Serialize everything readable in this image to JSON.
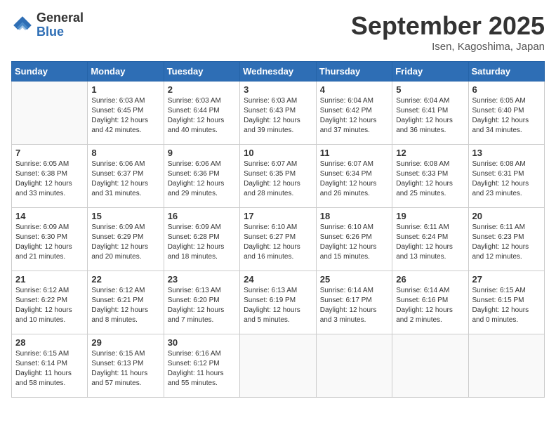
{
  "header": {
    "logo_general": "General",
    "logo_blue": "Blue",
    "title": "September 2025",
    "subtitle": "Isen, Kagoshima, Japan"
  },
  "days_of_week": [
    "Sunday",
    "Monday",
    "Tuesday",
    "Wednesday",
    "Thursday",
    "Friday",
    "Saturday"
  ],
  "weeks": [
    [
      {
        "day": "",
        "info": ""
      },
      {
        "day": "1",
        "info": "Sunrise: 6:03 AM\nSunset: 6:45 PM\nDaylight: 12 hours\nand 42 minutes."
      },
      {
        "day": "2",
        "info": "Sunrise: 6:03 AM\nSunset: 6:44 PM\nDaylight: 12 hours\nand 40 minutes."
      },
      {
        "day": "3",
        "info": "Sunrise: 6:03 AM\nSunset: 6:43 PM\nDaylight: 12 hours\nand 39 minutes."
      },
      {
        "day": "4",
        "info": "Sunrise: 6:04 AM\nSunset: 6:42 PM\nDaylight: 12 hours\nand 37 minutes."
      },
      {
        "day": "5",
        "info": "Sunrise: 6:04 AM\nSunset: 6:41 PM\nDaylight: 12 hours\nand 36 minutes."
      },
      {
        "day": "6",
        "info": "Sunrise: 6:05 AM\nSunset: 6:40 PM\nDaylight: 12 hours\nand 34 minutes."
      }
    ],
    [
      {
        "day": "7",
        "info": "Sunrise: 6:05 AM\nSunset: 6:38 PM\nDaylight: 12 hours\nand 33 minutes."
      },
      {
        "day": "8",
        "info": "Sunrise: 6:06 AM\nSunset: 6:37 PM\nDaylight: 12 hours\nand 31 minutes."
      },
      {
        "day": "9",
        "info": "Sunrise: 6:06 AM\nSunset: 6:36 PM\nDaylight: 12 hours\nand 29 minutes."
      },
      {
        "day": "10",
        "info": "Sunrise: 6:07 AM\nSunset: 6:35 PM\nDaylight: 12 hours\nand 28 minutes."
      },
      {
        "day": "11",
        "info": "Sunrise: 6:07 AM\nSunset: 6:34 PM\nDaylight: 12 hours\nand 26 minutes."
      },
      {
        "day": "12",
        "info": "Sunrise: 6:08 AM\nSunset: 6:33 PM\nDaylight: 12 hours\nand 25 minutes."
      },
      {
        "day": "13",
        "info": "Sunrise: 6:08 AM\nSunset: 6:31 PM\nDaylight: 12 hours\nand 23 minutes."
      }
    ],
    [
      {
        "day": "14",
        "info": "Sunrise: 6:09 AM\nSunset: 6:30 PM\nDaylight: 12 hours\nand 21 minutes."
      },
      {
        "day": "15",
        "info": "Sunrise: 6:09 AM\nSunset: 6:29 PM\nDaylight: 12 hours\nand 20 minutes."
      },
      {
        "day": "16",
        "info": "Sunrise: 6:09 AM\nSunset: 6:28 PM\nDaylight: 12 hours\nand 18 minutes."
      },
      {
        "day": "17",
        "info": "Sunrise: 6:10 AM\nSunset: 6:27 PM\nDaylight: 12 hours\nand 16 minutes."
      },
      {
        "day": "18",
        "info": "Sunrise: 6:10 AM\nSunset: 6:26 PM\nDaylight: 12 hours\nand 15 minutes."
      },
      {
        "day": "19",
        "info": "Sunrise: 6:11 AM\nSunset: 6:24 PM\nDaylight: 12 hours\nand 13 minutes."
      },
      {
        "day": "20",
        "info": "Sunrise: 6:11 AM\nSunset: 6:23 PM\nDaylight: 12 hours\nand 12 minutes."
      }
    ],
    [
      {
        "day": "21",
        "info": "Sunrise: 6:12 AM\nSunset: 6:22 PM\nDaylight: 12 hours\nand 10 minutes."
      },
      {
        "day": "22",
        "info": "Sunrise: 6:12 AM\nSunset: 6:21 PM\nDaylight: 12 hours\nand 8 minutes."
      },
      {
        "day": "23",
        "info": "Sunrise: 6:13 AM\nSunset: 6:20 PM\nDaylight: 12 hours\nand 7 minutes."
      },
      {
        "day": "24",
        "info": "Sunrise: 6:13 AM\nSunset: 6:19 PM\nDaylight: 12 hours\nand 5 minutes."
      },
      {
        "day": "25",
        "info": "Sunrise: 6:14 AM\nSunset: 6:17 PM\nDaylight: 12 hours\nand 3 minutes."
      },
      {
        "day": "26",
        "info": "Sunrise: 6:14 AM\nSunset: 6:16 PM\nDaylight: 12 hours\nand 2 minutes."
      },
      {
        "day": "27",
        "info": "Sunrise: 6:15 AM\nSunset: 6:15 PM\nDaylight: 12 hours\nand 0 minutes."
      }
    ],
    [
      {
        "day": "28",
        "info": "Sunrise: 6:15 AM\nSunset: 6:14 PM\nDaylight: 11 hours\nand 58 minutes."
      },
      {
        "day": "29",
        "info": "Sunrise: 6:15 AM\nSunset: 6:13 PM\nDaylight: 11 hours\nand 57 minutes."
      },
      {
        "day": "30",
        "info": "Sunrise: 6:16 AM\nSunset: 6:12 PM\nDaylight: 11 hours\nand 55 minutes."
      },
      {
        "day": "",
        "info": ""
      },
      {
        "day": "",
        "info": ""
      },
      {
        "day": "",
        "info": ""
      },
      {
        "day": "",
        "info": ""
      }
    ]
  ]
}
